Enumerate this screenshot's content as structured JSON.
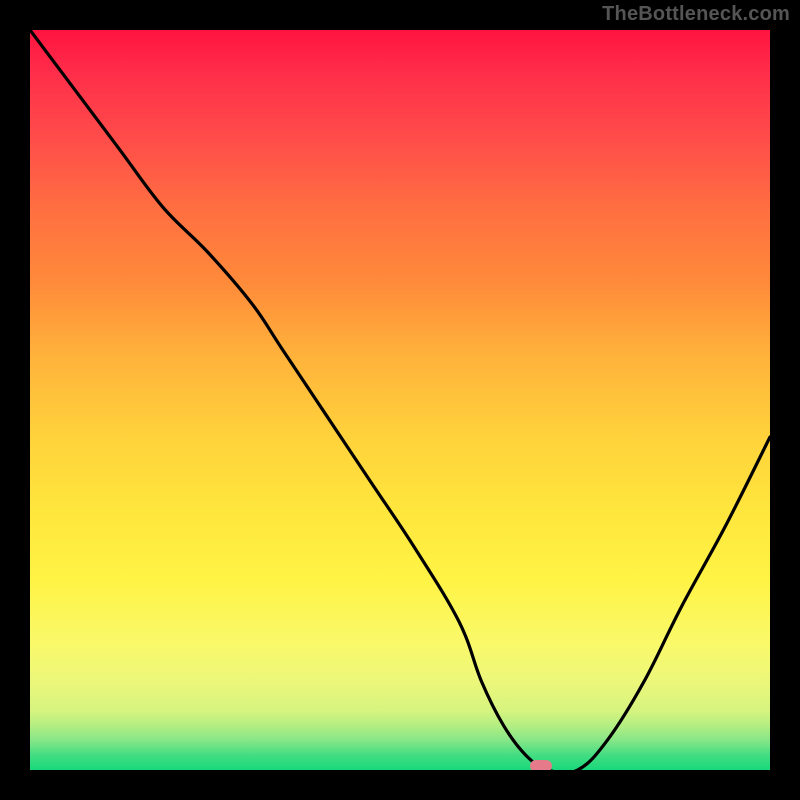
{
  "watermark": "TheBottleneck.com",
  "colors": {
    "background": "#000000",
    "marker": "#e47a8a",
    "curve": "#000000"
  },
  "chart_data": {
    "type": "line",
    "title": "",
    "xlabel": "",
    "ylabel": "",
    "xlim": [
      0,
      100
    ],
    "ylim": [
      0,
      100
    ],
    "series": [
      {
        "name": "bottleneck-curve",
        "x": [
          0,
          6,
          12,
          18,
          24,
          30,
          34,
          40,
          46,
          52,
          58,
          61,
          64,
          67,
          70,
          74,
          78,
          83,
          88,
          94,
          100
        ],
        "values": [
          100,
          92,
          84,
          76,
          70,
          63,
          57,
          48,
          39,
          30,
          20,
          12,
          6,
          2,
          0,
          0,
          4,
          12,
          22,
          33,
          45
        ]
      }
    ],
    "marker": {
      "x": 69,
      "y": 0
    },
    "gradient_hint": "spectral red-top to green-bottom"
  }
}
